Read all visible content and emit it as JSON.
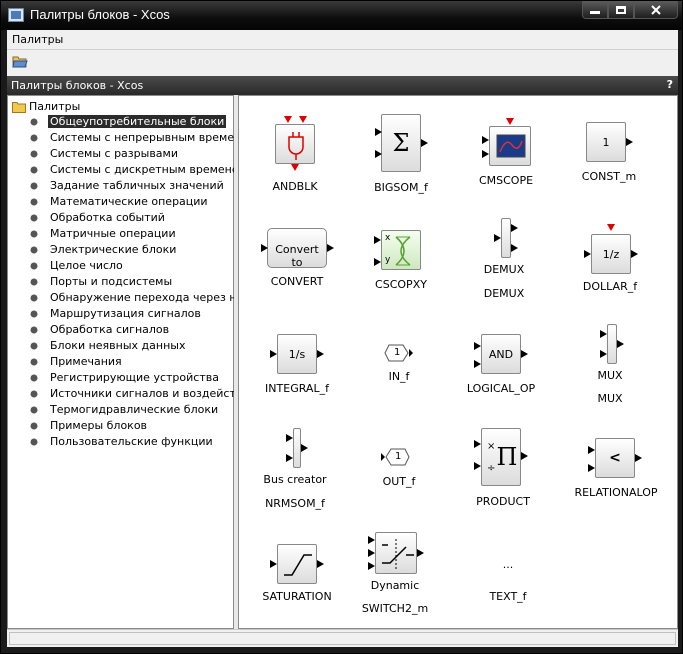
{
  "window": {
    "title": "Палитры блоков - Xcos"
  },
  "menubar": {
    "items": [
      "Палитры"
    ]
  },
  "panel": {
    "title": "Палитры блоков - Xcos",
    "help": "?"
  },
  "tree": {
    "root": "Палитры",
    "items": [
      "Общеупотребительные блоки",
      "Системы с непрерывным временем",
      "Системы с разрывами",
      "Системы с дискретным временем",
      "Задание табличных значений",
      "Математические операции",
      "Обработка событий",
      "Матричные операции",
      "Электрические блоки",
      "Целое число",
      "Порты и подсистемы",
      "Обнаружение перехода через нуль",
      "Маршрутизация сигналов",
      "Обработка сигналов",
      "Блоки неявных данных",
      "Примечания",
      "Регистрирующие устройства",
      "Источники сигналов и воздействий",
      "Термогидравлические блоки",
      "Примеры блоков",
      "Пользовательские функции"
    ],
    "selected_index": 0
  },
  "blocks": {
    "andblk": {
      "label": "ANDBLK"
    },
    "bigsom": {
      "label": "BIGSOM_f",
      "symbol": "Σ"
    },
    "cmscope": {
      "label": "CMSCOPE"
    },
    "const": {
      "label": "CONST_m",
      "value": "1"
    },
    "convert": {
      "label": "CONVERT",
      "text": "Convert to"
    },
    "cscopxy": {
      "label": "CSCOPXY",
      "x": "x",
      "y": "y"
    },
    "demux": {
      "label": "DEMUX",
      "inner": "DEMUX"
    },
    "dollar": {
      "label": "DOLLAR_f",
      "text": "1/z"
    },
    "integral": {
      "label": "INTEGRAL_f",
      "text": "1/s"
    },
    "in_f": {
      "label": "IN_f",
      "value": "1"
    },
    "logical_op": {
      "label": "LOGICAL_OP",
      "text": "AND"
    },
    "mux": {
      "label": "MUX",
      "inner": "MUX"
    },
    "nrmsom": {
      "label": "NRMSOM_f",
      "inner": "Bus creator"
    },
    "out_f": {
      "label": "OUT_f",
      "value": "1"
    },
    "product": {
      "label": "PRODUCT",
      "symbol": "Π",
      "times": "×",
      "div": "÷"
    },
    "relationalop": {
      "label": "RELATIONALOP",
      "text": "<"
    },
    "saturation": {
      "label": "SATURATION"
    },
    "switch2": {
      "label": "SWITCH2_m",
      "inner": "Dynamic"
    },
    "text_f": {
      "label": "TEXT_f",
      "inner": "..."
    }
  },
  "colors": {
    "titlebar": "#0d0d0d",
    "selection": "#2b2b2b",
    "port_event": "#e00000"
  }
}
